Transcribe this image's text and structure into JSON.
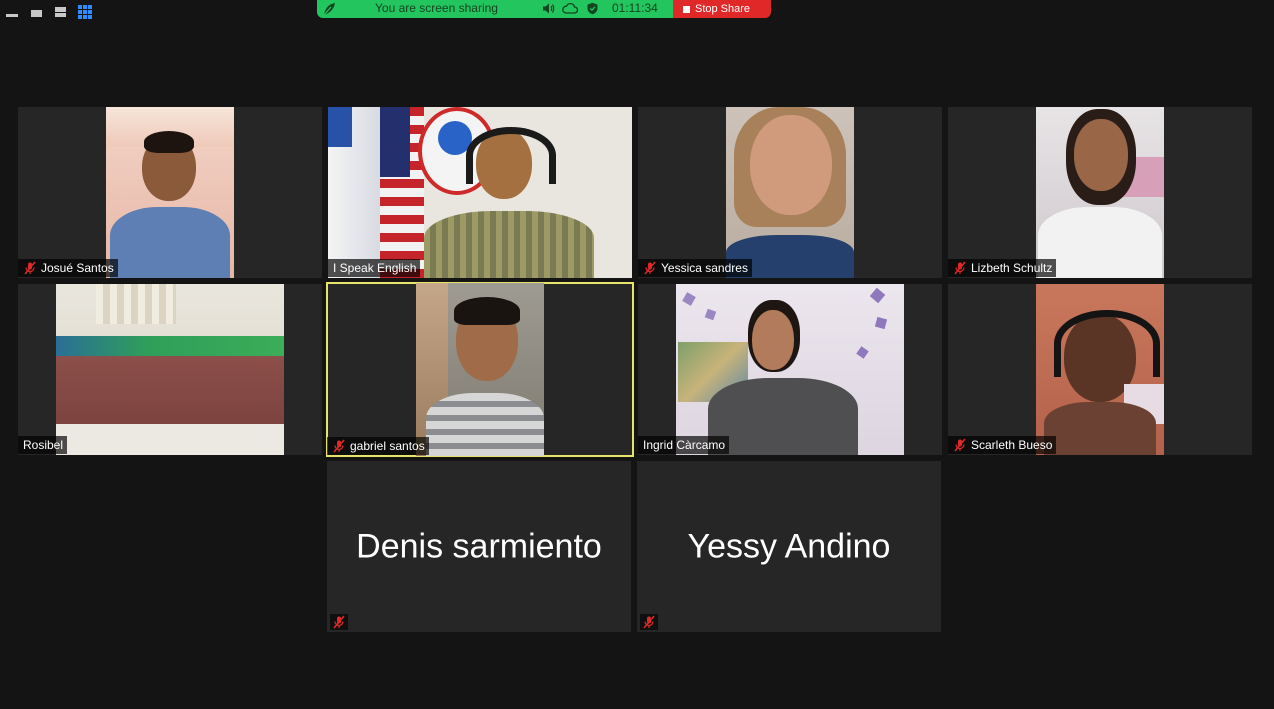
{
  "window": {
    "view_controls": [
      "minimize",
      "mini-window",
      "speaker-view",
      "gallery-view"
    ]
  },
  "share_banner": {
    "status_text": "You are screen sharing",
    "timer": "01:11:34",
    "stop_label": "Stop Share",
    "colors": {
      "banner": "#23c55e",
      "stop": "#e02828"
    }
  },
  "participants": [
    {
      "name": "Josué Santos",
      "muted": true
    },
    {
      "name": "I Speak English",
      "muted": false
    },
    {
      "name": "Yessica sandres",
      "muted": true
    },
    {
      "name": "Lizbeth Schultz",
      "muted": true
    },
    {
      "name": "Rosibel",
      "muted": false
    },
    {
      "name": "gabriel santos",
      "muted": true,
      "active_speaker": true
    },
    {
      "name": "Ingrid Càrcamo",
      "muted": false
    },
    {
      "name": "Scarleth Bueso",
      "muted": true
    },
    {
      "name": "Denis sarmiento",
      "muted": true,
      "video": false
    },
    {
      "name": "Yessy Andino",
      "muted": true,
      "video": false
    }
  ],
  "colors": {
    "background": "#141414",
    "tile": "#262626",
    "active_speaker_border": "#e8e46a",
    "muted_icon": "#e02828"
  }
}
